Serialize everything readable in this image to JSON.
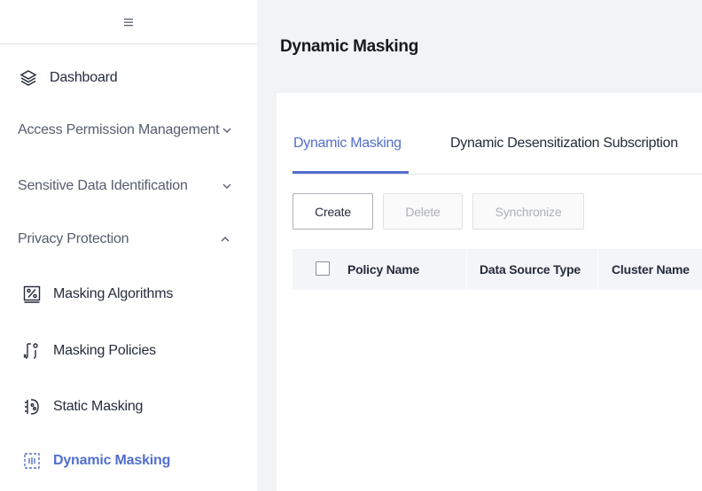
{
  "sidebar": {
    "items": [
      {
        "label": "Dashboard",
        "icon": "layers-icon"
      },
      {
        "label": "Access Permission Management",
        "icon": "chevron-down-icon"
      },
      {
        "label": "Sensitive Data Identification",
        "icon": "chevron-down-icon"
      },
      {
        "label": "Privacy Protection",
        "icon": "chevron-up-icon"
      },
      {
        "label": "Masking Algorithms",
        "icon": "percent-box-icon"
      },
      {
        "label": "Masking Policies",
        "icon": "policy-icon"
      },
      {
        "label": "Static Masking",
        "icon": "static-masking-icon"
      },
      {
        "label": "Dynamic Masking",
        "icon": "dynamic-masking-icon"
      }
    ]
  },
  "main": {
    "title": "Dynamic Masking",
    "tabs": [
      {
        "label": "Dynamic Masking",
        "active": true
      },
      {
        "label": "Dynamic Desensitization Subscription",
        "active": false
      }
    ],
    "toolbar": {
      "create_label": "Create",
      "delete_label": "Delete",
      "synchronize_label": "Synchronize"
    },
    "table": {
      "columns": [
        "Policy Name",
        "Data Source Type",
        "Cluster Name"
      ]
    }
  },
  "colors": {
    "accent": "#526ecc",
    "text": "#252b3a",
    "background": "#f1f3f5"
  }
}
